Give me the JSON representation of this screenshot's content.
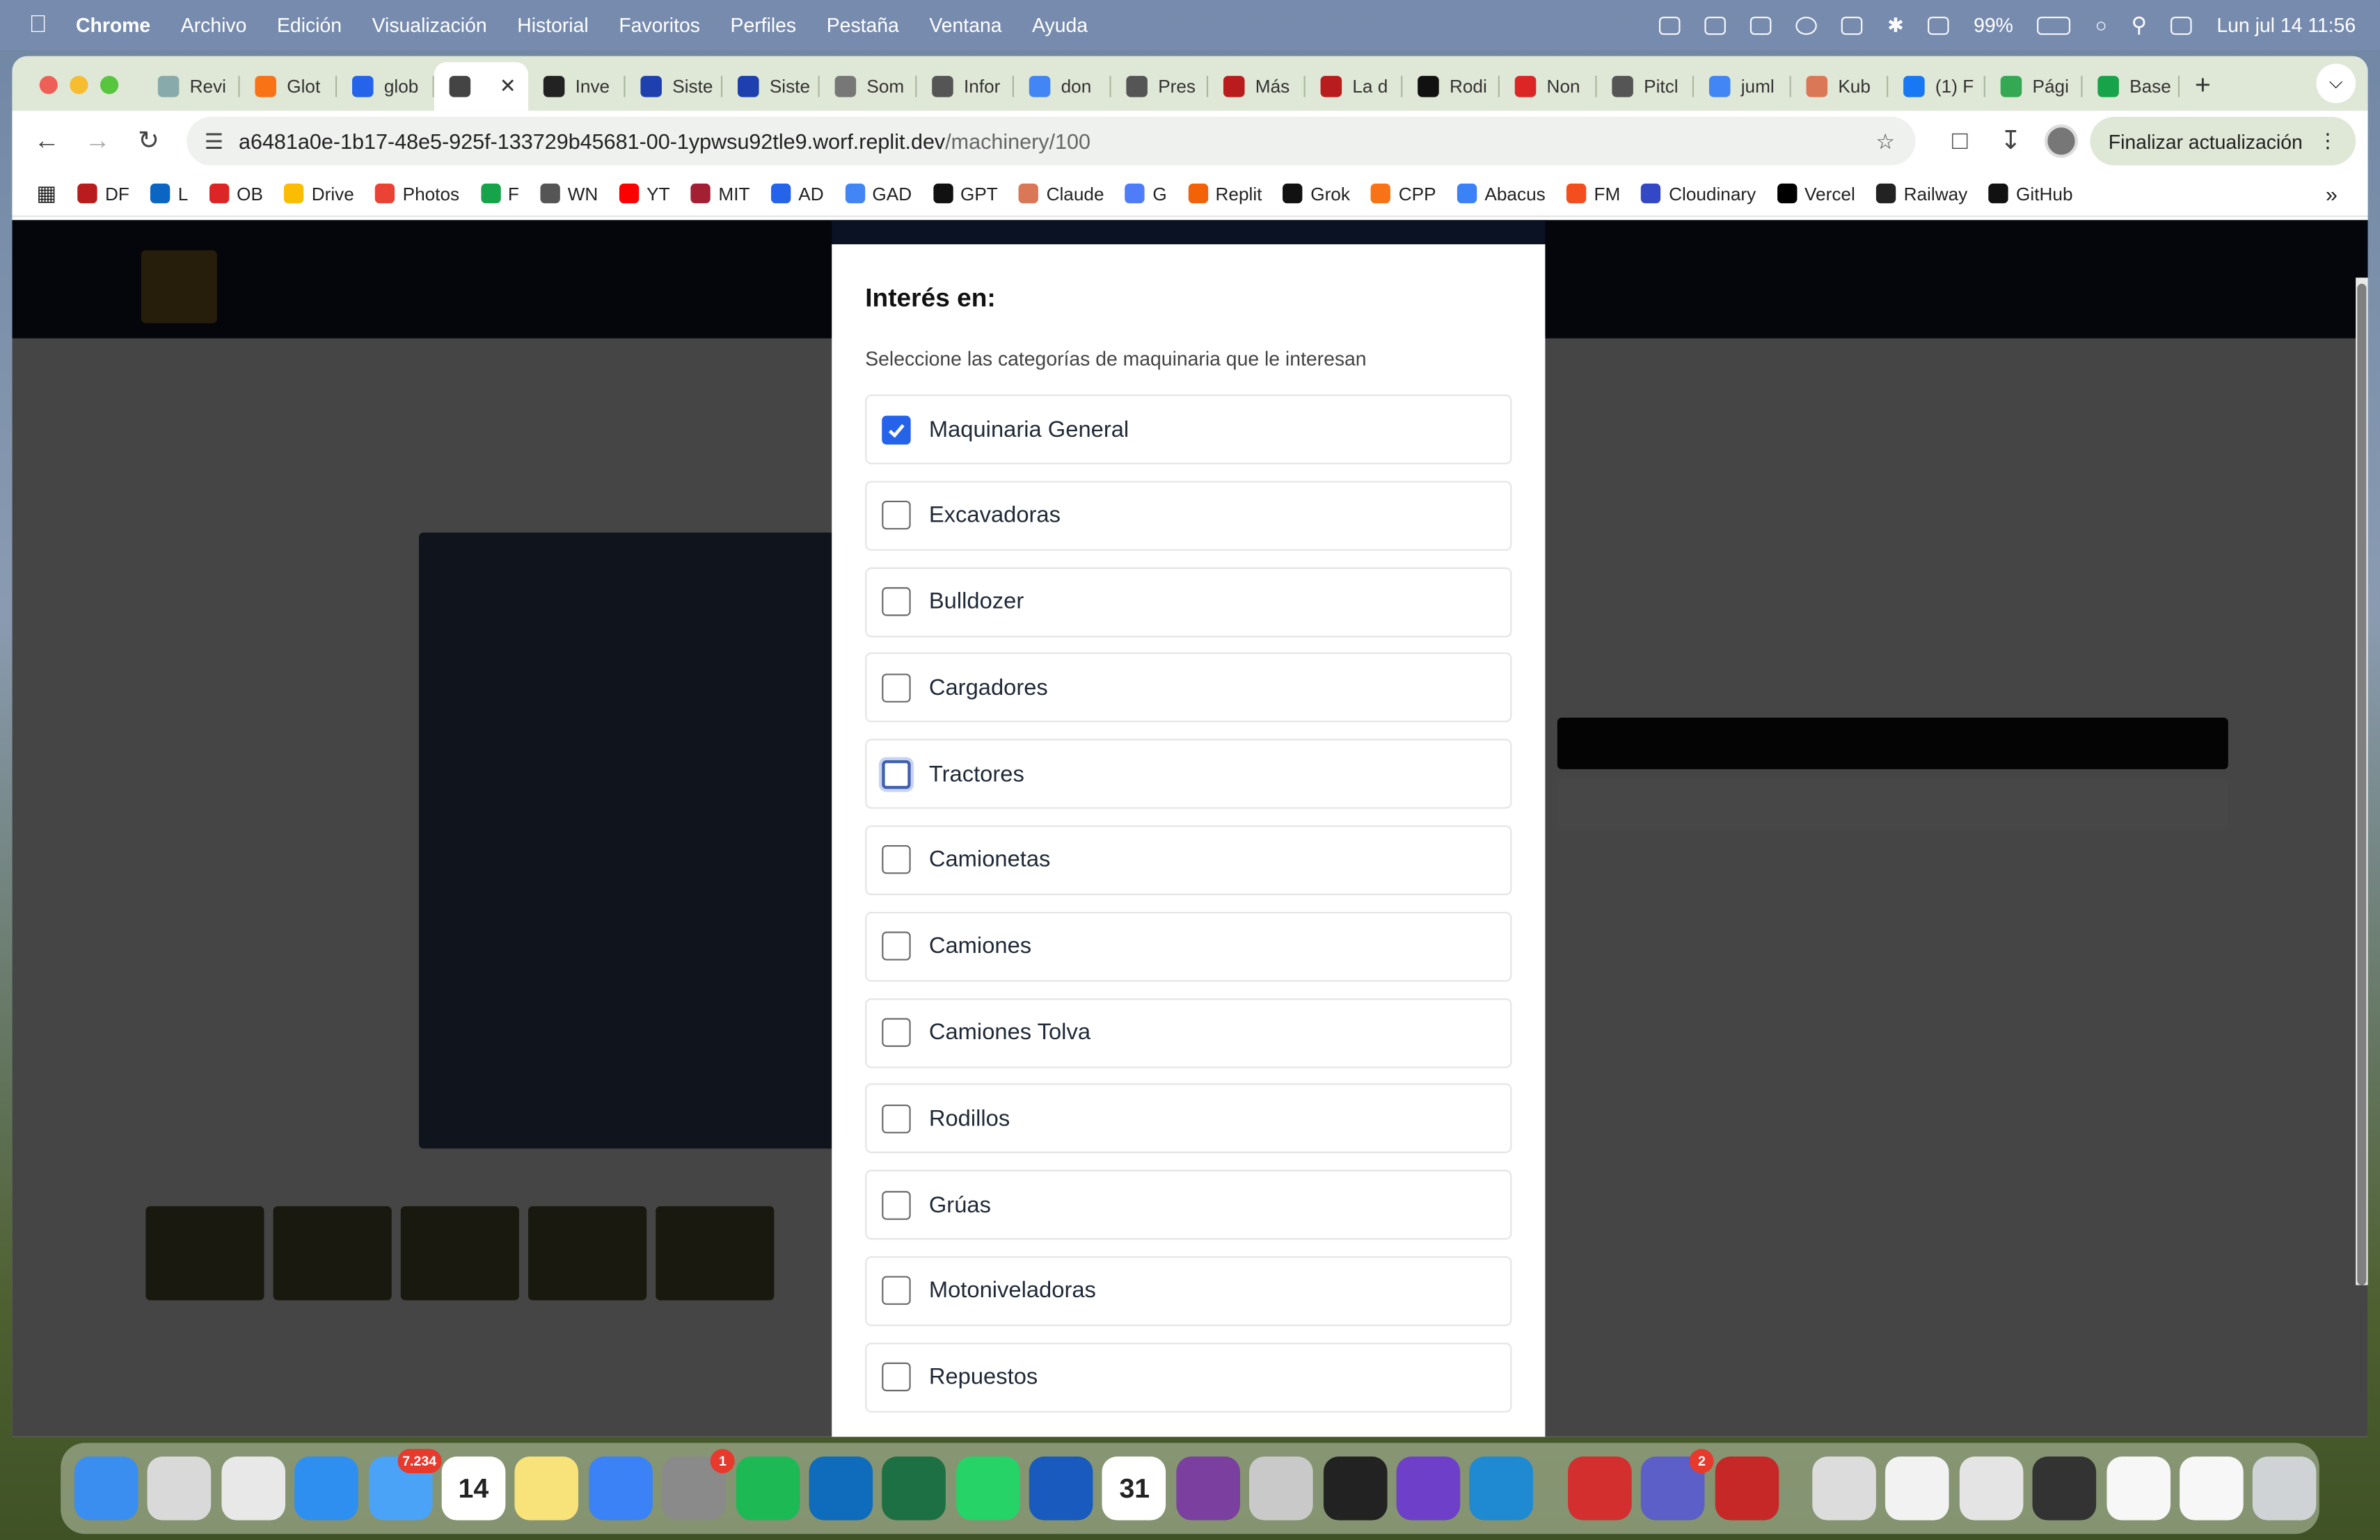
{
  "menubar": {
    "app": "Chrome",
    "items": [
      "Archivo",
      "Edición",
      "Visualización",
      "Historial",
      "Favoritos",
      "Perfiles",
      "Pestaña",
      "Ventana",
      "Ayuda"
    ],
    "battery": "99%",
    "datetime": "Lun jul 14  11:56"
  },
  "tabs": [
    {
      "label": "Revi",
      "color": "#8aa"
    },
    {
      "label": "Glot",
      "color": "#f97316"
    },
    {
      "label": "glob",
      "color": "#2563eb"
    },
    {
      "label": "",
      "color": "#444",
      "active": true
    },
    {
      "label": "Inve",
      "color": "#222"
    },
    {
      "label": "Siste",
      "color": "#1e40af"
    },
    {
      "label": "Siste",
      "color": "#1e40af"
    },
    {
      "label": "Som",
      "color": "#777"
    },
    {
      "label": "Infor",
      "color": "#555"
    },
    {
      "label": "don",
      "color": "#4285f4"
    },
    {
      "label": "Pres",
      "color": "#555"
    },
    {
      "label": "Más",
      "color": "#b91c1c"
    },
    {
      "label": "La d",
      "color": "#b91c1c"
    },
    {
      "label": "Rodi",
      "color": "#111"
    },
    {
      "label": "Non",
      "color": "#dc2626"
    },
    {
      "label": "Pitcl",
      "color": "#555"
    },
    {
      "label": "juml",
      "color": "#4285f4"
    },
    {
      "label": "Kub",
      "color": "#d97757"
    },
    {
      "label": "(1) F",
      "color": "#1877f2"
    },
    {
      "label": "Pági",
      "color": "#34a853"
    },
    {
      "label": "Base",
      "color": "#16a34a"
    }
  ],
  "tab_close": "✕",
  "new_tab": "+",
  "url": {
    "host": "a6481a0e-1b17-48e5-925f-133729b45681-00-1ypwsu92tle9.worf.replit.dev",
    "path": "/machinery/100"
  },
  "update_button": "Finalizar actualización",
  "bookmarks": [
    {
      "label": "DF",
      "color": "#b91c1c"
    },
    {
      "label": "L",
      "color": "#0a66c2"
    },
    {
      "label": "OB",
      "color": "#dc2626"
    },
    {
      "label": "Drive",
      "color": "#fbbc04"
    },
    {
      "label": "Photos",
      "color": "#ea4335"
    },
    {
      "label": "F",
      "color": "#16a34a"
    },
    {
      "label": "WN",
      "color": "#555"
    },
    {
      "label": "YT",
      "color": "#ff0000"
    },
    {
      "label": "MIT",
      "color": "#a31f34"
    },
    {
      "label": "AD",
      "color": "#2563eb"
    },
    {
      "label": "GAD",
      "color": "#4285f4"
    },
    {
      "label": "GPT",
      "color": "#111"
    },
    {
      "label": "Claude",
      "color": "#d97757"
    },
    {
      "label": "G",
      "color": "#4f7df9"
    },
    {
      "label": "Replit",
      "color": "#f26207"
    },
    {
      "label": "Grok",
      "color": "#111"
    },
    {
      "label": "CPP",
      "color": "#f97316"
    },
    {
      "label": "Abacus",
      "color": "#3b82f6"
    },
    {
      "label": "FM",
      "color": "#f24e1e"
    },
    {
      "label": "Cloudinary",
      "color": "#3448c5"
    },
    {
      "label": "Vercel",
      "color": "#000"
    },
    {
      "label": "Railway",
      "color": "#222"
    },
    {
      "label": "GitHub",
      "color": "#111"
    }
  ],
  "modal": {
    "title": "Interés en:",
    "subtitle": "Seleccione las categorías de maquinaria que le interesan",
    "options": [
      {
        "label": "Maquinaria General",
        "checked": true
      },
      {
        "label": "Excavadoras",
        "checked": false
      },
      {
        "label": "Bulldozer",
        "checked": false
      },
      {
        "label": "Cargadores",
        "checked": false
      },
      {
        "label": "Tractores",
        "checked": false,
        "focused": true
      },
      {
        "label": "Camionetas",
        "checked": false
      },
      {
        "label": "Camiones",
        "checked": false
      },
      {
        "label": "Camiones Tolva",
        "checked": false
      },
      {
        "label": "Rodillos",
        "checked": false
      },
      {
        "label": "Grúas",
        "checked": false
      },
      {
        "label": "Motoniveladoras",
        "checked": false
      },
      {
        "label": "Repuestos",
        "checked": false
      }
    ]
  },
  "dock": {
    "apps": [
      {
        "name": "finder",
        "color": "#3a8ef0"
      },
      {
        "name": "launchpad",
        "color": "#d9d9d9"
      },
      {
        "name": "chrome",
        "color": "#e8e8e8"
      },
      {
        "name": "safari",
        "color": "#2f8ff0"
      },
      {
        "name": "mail",
        "color": "#4aa3f7",
        "badge": "7.234"
      },
      {
        "name": "calendar",
        "color": "#ffffff",
        "text": "14"
      },
      {
        "name": "notes",
        "color": "#f8e27a"
      },
      {
        "name": "keynote",
        "color": "#3b82f6"
      },
      {
        "name": "settings",
        "color": "#8a8a8a",
        "badge": "1"
      },
      {
        "name": "spotify",
        "color": "#1db954"
      },
      {
        "name": "outlook",
        "color": "#0f6cbd"
      },
      {
        "name": "excel",
        "color": "#1d7044"
      },
      {
        "name": "whatsapp",
        "color": "#25d366"
      },
      {
        "name": "word",
        "color": "#185abd"
      },
      {
        "name": "calendar-31",
        "color": "#ffffff",
        "text": "31"
      },
      {
        "name": "circle-app",
        "color": "#7b3fa0"
      },
      {
        "name": "phone-mirror",
        "color": "#c9c9c9"
      },
      {
        "name": "replit",
        "color": "#222"
      },
      {
        "name": "github-desktop",
        "color": "#6e40c9"
      },
      {
        "name": "vscode",
        "color": "#1f8ad2"
      },
      {
        "name": "acrobat",
        "color": "#d32f2f"
      },
      {
        "name": "teams",
        "color": "#5b5fc7",
        "badge": "2"
      },
      {
        "name": "pdf-app",
        "color": "#c62828"
      },
      {
        "name": "documents",
        "color": "#dcdcdc"
      },
      {
        "name": "doc-thumb-1",
        "color": "#f2f2f2"
      },
      {
        "name": "doc-thumb-2",
        "color": "#e4e4e4"
      },
      {
        "name": "terminal-thumb",
        "color": "#333"
      },
      {
        "name": "doc-thumb-3",
        "color": "#f7f7f7"
      },
      {
        "name": "doc-thumb-4",
        "color": "#f7f7f7"
      },
      {
        "name": "trash",
        "color": "#cfd3d6"
      }
    ]
  }
}
